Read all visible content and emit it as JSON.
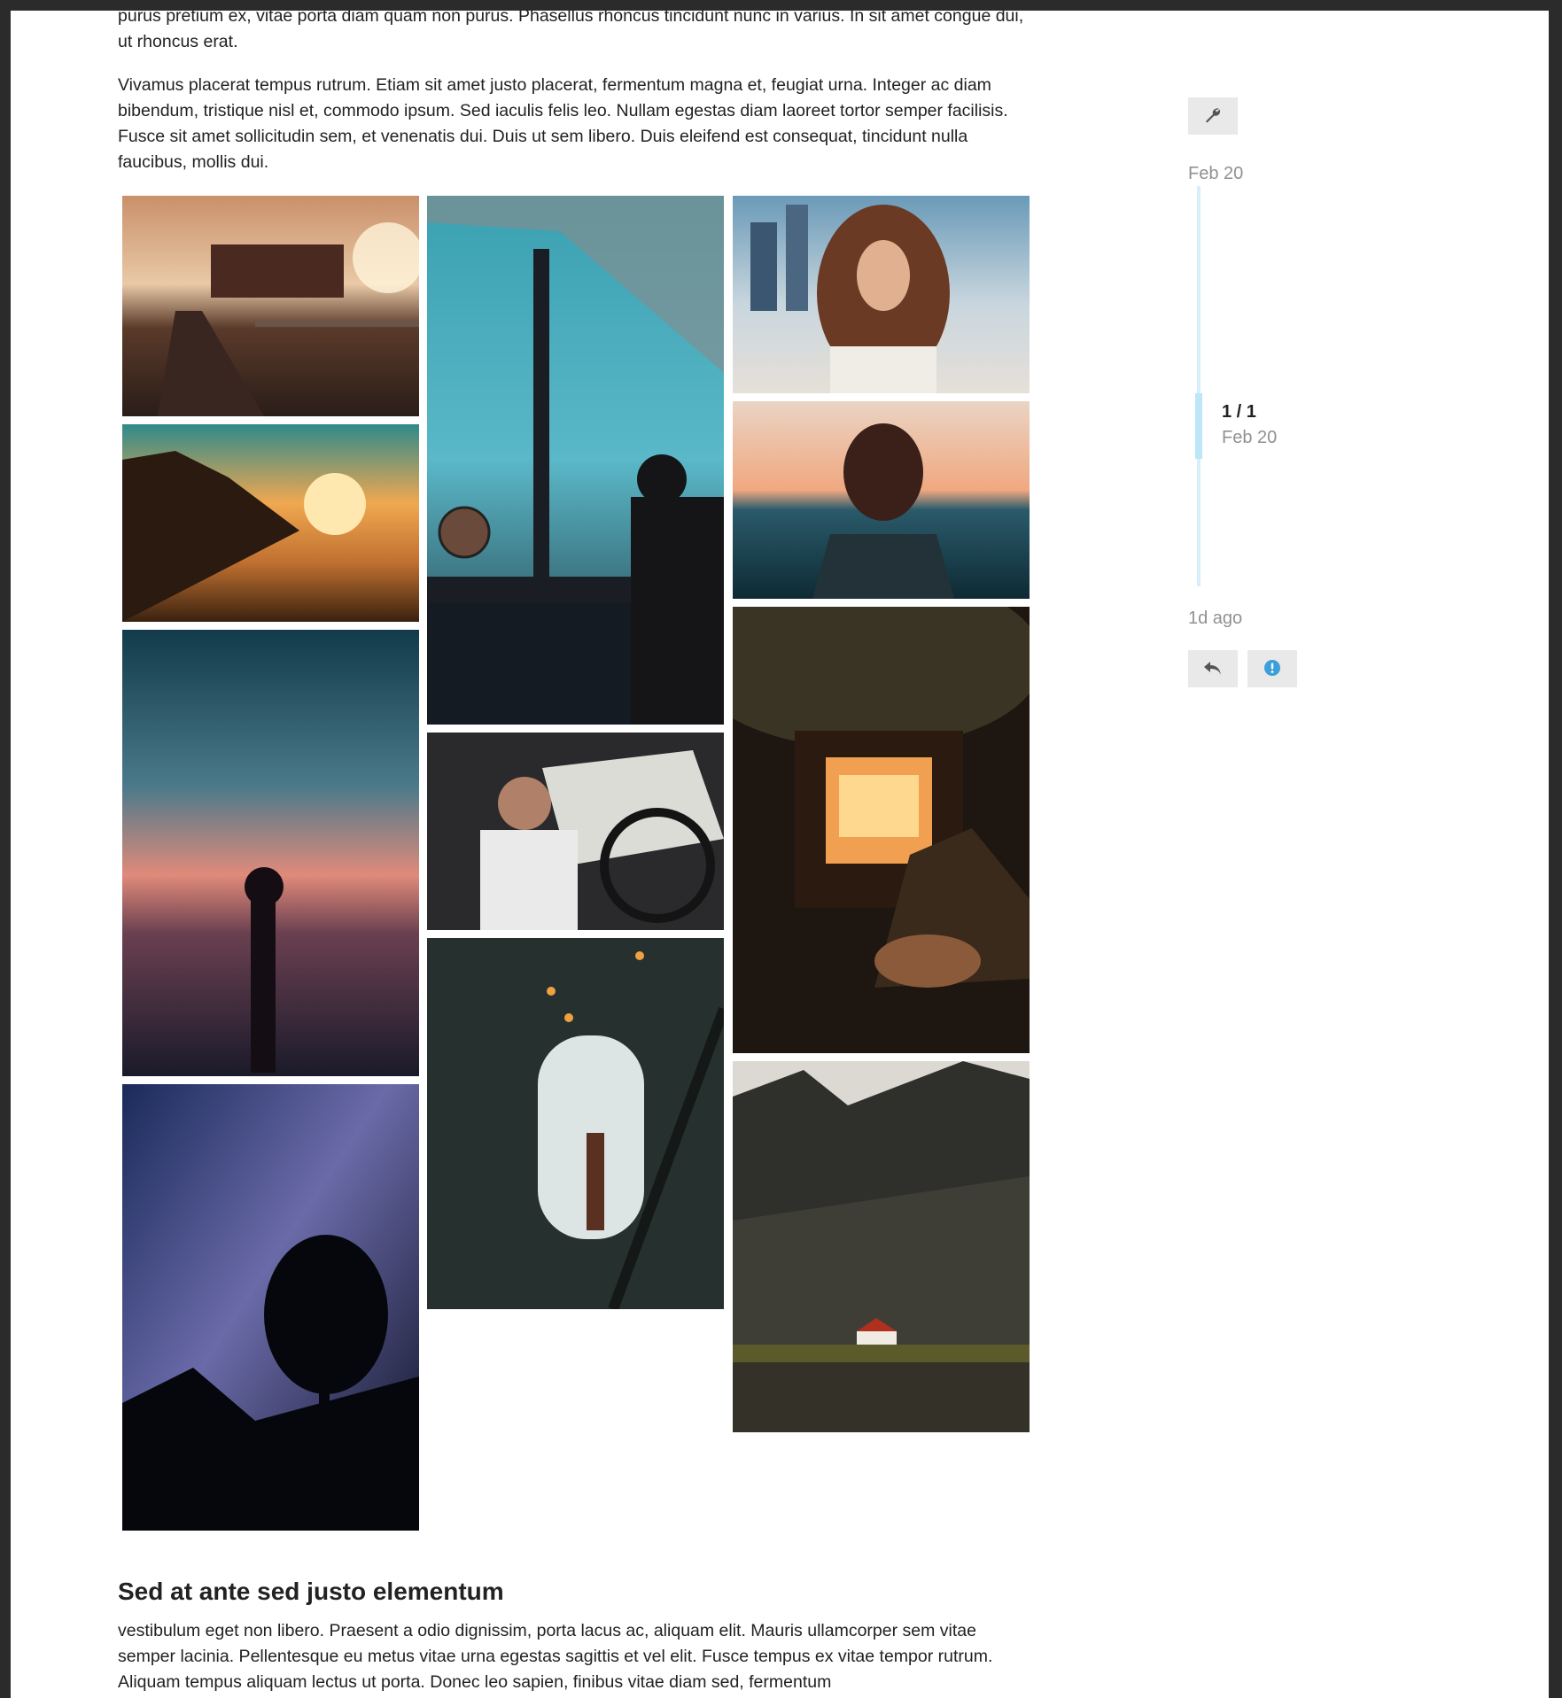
{
  "post": {
    "paragraph_top": "purus pretium ex, vitae porta diam quam non purus. Phasellus rhoncus tincidunt nunc in varius. In sit amet congue dui, ut rhoncus erat.",
    "paragraph_mid": "Vivamus placerat tempus rutrum. Etiam sit amet justo placerat, fermentum magna et, feugiat urna. Integer ac diam bibendum, tristique nisl et, commodo ipsum. Sed iaculis felis leo. Nullam egestas diam laoreet tortor semper facilisis. Fusce sit amet sollicitudin sem, et venenatis dui. Duis ut sem libero. Duis eleifend est consequat, tincidunt nulla faucibus, mollis dui.",
    "heading": "Sed at ante sed justo elementum",
    "paragraph_bottom": "vestibulum eget non libero. Praesent a odio dignissim, porta lacus ac, aliquam elit. Mauris ullamcorper sem vitae semper lacinia. Pellentesque eu metus vitae urna egestas sagittis et vel elit. Fusce tempus ex vitae tempor rutrum. Aliquam tempus aliquam lectus ut porta. Donec leo sapien, finibus vitae diam sed, fermentum"
  },
  "gallery": {
    "photos": [
      {
        "name": "boardwalk-sunset-photo"
      },
      {
        "name": "coastal-sunset-photo"
      },
      {
        "name": "shaka-hand-ocean-photo"
      },
      {
        "name": "milky-way-tree-photo"
      },
      {
        "name": "window-city-lights-photo"
      },
      {
        "name": "car-driver-photo"
      },
      {
        "name": "stairwell-window-photo"
      },
      {
        "name": "windswept-hair-photo"
      },
      {
        "name": "sea-sunset-portrait-photo"
      },
      {
        "name": "fireplace-boots-photo"
      },
      {
        "name": "mountain-church-photo"
      }
    ]
  },
  "timeline": {
    "admin_icon": "wrench-icon",
    "start_date": "Feb 20",
    "progress_count": "1 / 1",
    "progress_date": "Feb 20",
    "last_activity": "1d ago",
    "reply_icon": "reply-icon",
    "notice_icon": "exclamation-circle-icon"
  },
  "colors": {
    "accent": "#3c9fd9",
    "track": "#d6f0fb",
    "muted_text": "#919191",
    "button_bg": "#e9e9e9"
  }
}
